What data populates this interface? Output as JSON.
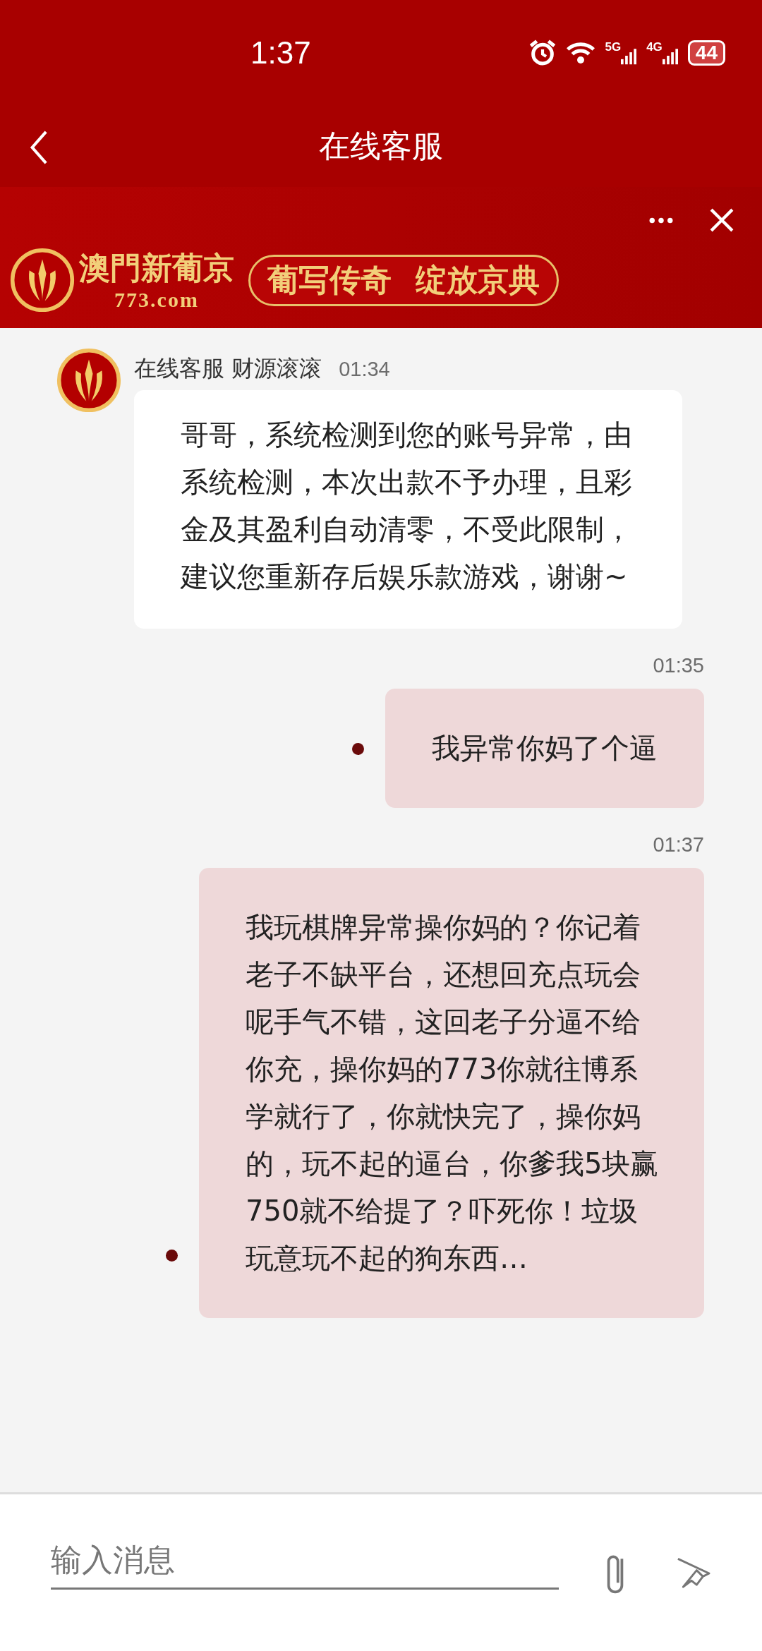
{
  "status_bar": {
    "time": "1:37",
    "network_1": "5G",
    "network_2": "4G",
    "battery": "44"
  },
  "header": {
    "title": "在线客服"
  },
  "banner": {
    "brand": "澳門新葡京",
    "domain": "773.com",
    "slogan_1": "葡写传奇",
    "slogan_2": "绽放京典"
  },
  "messages": [
    {
      "kind": "received",
      "sender": "在线客服 财源滚滚",
      "time": "01:34",
      "text": "哥哥，系统检测到您的账号异常，由系统检测，本次出款不予办理，且彩金及其盈利自动清零，不受此限制，建议您重新存后娱乐款游戏，谢谢~"
    },
    {
      "kind": "sent",
      "time": "01:35",
      "unread": true,
      "text": "我异常你妈了个逼"
    },
    {
      "kind": "sent",
      "time": "01:37",
      "unread": true,
      "text": "我玩棋牌异常操你妈的？你记着老子不缺平台，还想回充点玩会呢手气不错，这回老子分逼不给你充，操你妈的773你就往博系学就行了，你就快完了，操你妈的，玩不起的逼台，你爹我5块赢750就不给提了？吓死你！垃圾玩意玩不起的狗东西…"
    }
  ],
  "composer": {
    "placeholder": "输入消息"
  }
}
